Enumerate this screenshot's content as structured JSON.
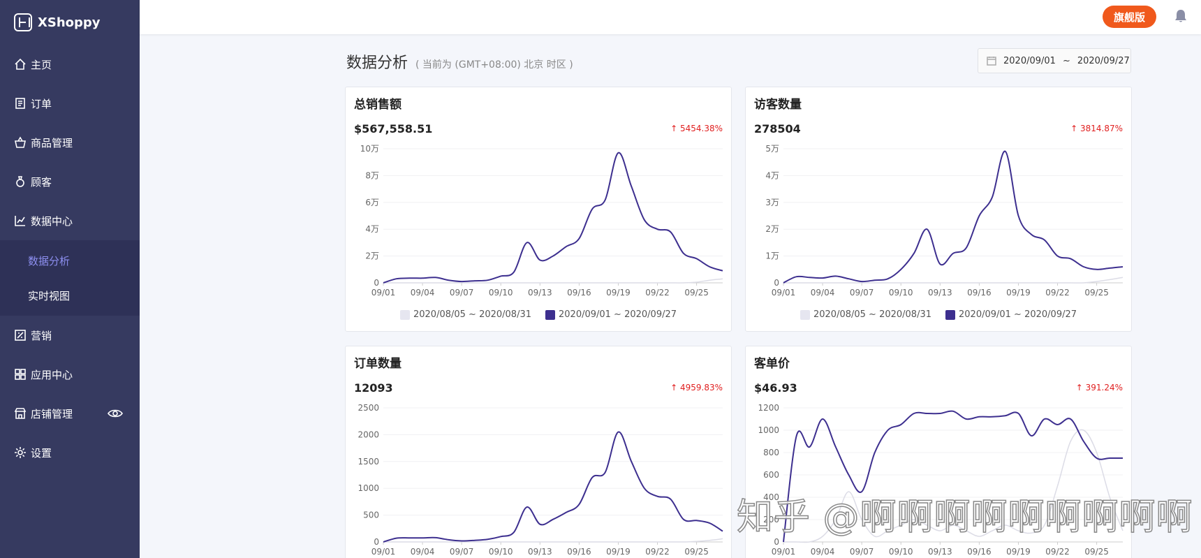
{
  "brand": {
    "name": "XShoppy"
  },
  "topbar": {
    "plan_badge": "旗舰版"
  },
  "sidebar": {
    "items": [
      {
        "label": "主页",
        "icon": "home-icon"
      },
      {
        "label": "订单",
        "icon": "order-icon"
      },
      {
        "label": "商品管理",
        "icon": "basket-icon"
      },
      {
        "label": "顾客",
        "icon": "customer-icon"
      },
      {
        "label": "数据中心",
        "icon": "chart-icon"
      },
      {
        "label": "营销",
        "icon": "marketing-icon"
      },
      {
        "label": "应用中心",
        "icon": "apps-icon"
      },
      {
        "label": "店铺管理",
        "icon": "store-icon"
      },
      {
        "label": "设置",
        "icon": "gear-icon"
      }
    ],
    "sub_items": [
      {
        "label": "数据分析",
        "active": true
      },
      {
        "label": "实时视图",
        "active": false
      }
    ]
  },
  "header": {
    "title": "数据分析",
    "subtitle": "( 当前为 (GMT+08:00) 北京 时区 )",
    "date_start": "2020/09/01",
    "date_sep": "~",
    "date_end": "2020/09/27"
  },
  "colors": {
    "primary_series": "#3d2f8f",
    "compare_series": "#e6e6f0",
    "growth": "#e02020",
    "badge": "#f0591c"
  },
  "cards": [
    {
      "title": "总销售额",
      "value": "$567,558.51",
      "growth": "↑ 5454.38%"
    },
    {
      "title": "访客数量",
      "value": "278504",
      "growth": "↑ 3814.87%"
    },
    {
      "title": "订单数量",
      "value": "12093",
      "growth": "↑ 4959.83%"
    },
    {
      "title": "客单价",
      "value": "$46.93",
      "growth": "↑ 391.24%"
    }
  ],
  "legend": {
    "compare": "2020/08/05 ~ 2020/08/31",
    "current": "2020/09/01 ~ 2020/09/27"
  },
  "watermark": "知乎 @啊啊啊啊啊啊啊啊啊",
  "chart_data": [
    {
      "type": "line",
      "title": "总销售额",
      "x": [
        "09/01",
        "09/02",
        "09/03",
        "09/04",
        "09/05",
        "09/06",
        "09/07",
        "09/08",
        "09/09",
        "09/10",
        "09/11",
        "09/12",
        "09/13",
        "09/14",
        "09/15",
        "09/16",
        "09/17",
        "09/18",
        "09/19",
        "09/20",
        "09/21",
        "09/22",
        "09/23",
        "09/24",
        "09/25",
        "09/26",
        "09/27"
      ],
      "xticks": [
        "09/01",
        "09/04",
        "09/07",
        "09/10",
        "09/13",
        "09/16",
        "09/19",
        "09/22",
        "09/25"
      ],
      "yticks": [
        "0",
        "2万",
        "4万",
        "6万",
        "8万",
        "10万"
      ],
      "ylim": [
        0,
        100000
      ],
      "series": [
        {
          "name": "2020/09/01 ~ 2020/09/27",
          "values": [
            0,
            3000,
            3500,
            3500,
            4000,
            2000,
            1000,
            1500,
            2000,
            5000,
            8000,
            30000,
            17000,
            20000,
            27000,
            33000,
            55000,
            62000,
            97000,
            72000,
            47000,
            40000,
            38000,
            22000,
            18000,
            12000,
            9000
          ]
        },
        {
          "name": "2020/08/05 ~ 2020/08/31",
          "values": [
            0,
            0,
            0,
            0,
            0,
            0,
            0,
            0,
            0,
            0,
            0,
            0,
            0,
            0,
            0,
            0,
            0,
            0,
            0,
            0,
            0,
            0,
            0,
            0,
            500,
            2000,
            3000
          ]
        }
      ]
    },
    {
      "type": "line",
      "title": "访客数量",
      "x": [
        "09/01",
        "09/02",
        "09/03",
        "09/04",
        "09/05",
        "09/06",
        "09/07",
        "09/08",
        "09/09",
        "09/10",
        "09/11",
        "09/12",
        "09/13",
        "09/14",
        "09/15",
        "09/16",
        "09/17",
        "09/18",
        "09/19",
        "09/20",
        "09/21",
        "09/22",
        "09/23",
        "09/24",
        "09/25",
        "09/26",
        "09/27"
      ],
      "xticks": [
        "09/01",
        "09/04",
        "09/07",
        "09/10",
        "09/13",
        "09/16",
        "09/19",
        "09/22",
        "09/25"
      ],
      "yticks": [
        "0",
        "1万",
        "2万",
        "3万",
        "4万",
        "5万"
      ],
      "ylim": [
        0,
        50000
      ],
      "series": [
        {
          "name": "2020/09/01 ~ 2020/09/27",
          "values": [
            0,
            2300,
            2000,
            1800,
            2500,
            1500,
            500,
            1000,
            1500,
            5000,
            11000,
            20000,
            7000,
            11000,
            13000,
            25000,
            32000,
            49000,
            25000,
            18000,
            16000,
            10000,
            9000,
            6000,
            5000,
            5500,
            6000
          ]
        },
        {
          "name": "2020/08/05 ~ 2020/08/31",
          "values": [
            0,
            0,
            0,
            0,
            0,
            0,
            0,
            0,
            0,
            0,
            0,
            0,
            0,
            0,
            0,
            0,
            0,
            0,
            0,
            0,
            0,
            0,
            0,
            0,
            500,
            1200,
            2000
          ]
        }
      ]
    },
    {
      "type": "line",
      "title": "订单数量",
      "x": [
        "09/01",
        "09/02",
        "09/03",
        "09/04",
        "09/05",
        "09/06",
        "09/07",
        "09/08",
        "09/09",
        "09/10",
        "09/11",
        "09/12",
        "09/13",
        "09/14",
        "09/15",
        "09/16",
        "09/17",
        "09/18",
        "09/19",
        "09/20",
        "09/21",
        "09/22",
        "09/23",
        "09/24",
        "09/25",
        "09/26",
        "09/27"
      ],
      "xticks": [
        "09/01",
        "09/04",
        "09/07",
        "09/10",
        "09/13",
        "09/16",
        "09/19",
        "09/22",
        "09/25"
      ],
      "yticks": [
        "0",
        "500",
        "1000",
        "1500",
        "2000",
        "2500"
      ],
      "ylim": [
        0,
        2500
      ],
      "series": [
        {
          "name": "2020/09/01 ~ 2020/09/27",
          "values": [
            0,
            70,
            75,
            75,
            80,
            40,
            20,
            30,
            50,
            100,
            180,
            650,
            330,
            420,
            550,
            700,
            1200,
            1300,
            2050,
            1500,
            1000,
            850,
            800,
            420,
            400,
            350,
            200
          ]
        },
        {
          "name": "2020/08/05 ~ 2020/08/31",
          "values": [
            0,
            0,
            0,
            0,
            0,
            0,
            0,
            0,
            0,
            0,
            0,
            0,
            0,
            0,
            0,
            0,
            0,
            0,
            0,
            0,
            0,
            0,
            0,
            0,
            10,
            30,
            60
          ]
        }
      ]
    },
    {
      "type": "line",
      "title": "客单价",
      "x": [
        "09/01",
        "09/02",
        "09/03",
        "09/04",
        "09/05",
        "09/06",
        "09/07",
        "09/08",
        "09/09",
        "09/10",
        "09/11",
        "09/12",
        "09/13",
        "09/14",
        "09/15",
        "09/16",
        "09/17",
        "09/18",
        "09/19",
        "09/20",
        "09/21",
        "09/22",
        "09/23",
        "09/24",
        "09/25",
        "09/26",
        "09/27"
      ],
      "xticks": [
        "09/01",
        "09/04",
        "09/07",
        "09/10",
        "09/13",
        "09/16",
        "09/19",
        "09/22",
        "09/25"
      ],
      "yticks": [
        "0",
        "200",
        "400",
        "600",
        "800",
        "1000",
        "1200"
      ],
      "ylim": [
        0,
        1200
      ],
      "series": [
        {
          "name": "2020/09/01 ~ 2020/09/27",
          "values": [
            0,
            950,
            850,
            1100,
            850,
            600,
            450,
            800,
            1000,
            1050,
            1150,
            1150,
            1150,
            1170,
            1100,
            1120,
            1120,
            1130,
            1150,
            950,
            1100,
            1050,
            1100,
            900,
            750,
            750,
            750
          ]
        },
        {
          "name": "2020/08/05 ~ 2020/08/31",
          "values": [
            0,
            0,
            0,
            50,
            200,
            450,
            200,
            50,
            100,
            150,
            200,
            150,
            100,
            150,
            100,
            50,
            100,
            150,
            100,
            80,
            150,
            500,
            900,
            1000,
            800,
            400,
            100
          ]
        }
      ]
    }
  ]
}
